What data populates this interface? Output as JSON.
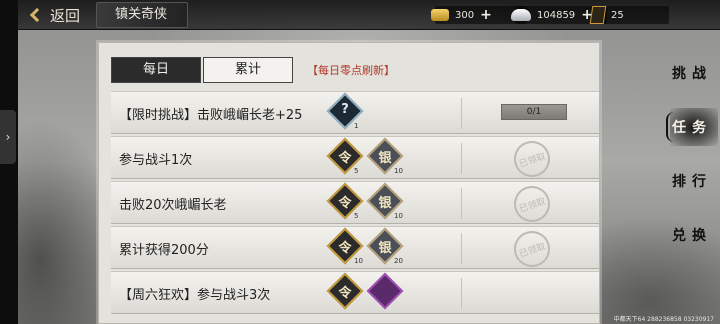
{
  "header": {
    "back_label": "返回",
    "title": "镇关奇侠",
    "gold": "300",
    "silver": "104859",
    "tokens": "25"
  },
  "tabs": {
    "daily": "每日",
    "cumulative": "累计",
    "refresh_note": "【每日零点刷新】"
  },
  "tasks": [
    {
      "name": "【限时挑战】击败峨嵋长老+25",
      "rewards": [
        {
          "icon": "mystery-box-icon",
          "count": "1"
        }
      ],
      "status": "0/1"
    },
    {
      "name": "参与战斗1次",
      "rewards": [
        {
          "icon": "token-icon",
          "count": "5"
        },
        {
          "icon": "silver-icon",
          "count": "10"
        }
      ],
      "status": "已领取"
    },
    {
      "name": "击败20次峨嵋长老",
      "rewards": [
        {
          "icon": "token-icon",
          "count": "5"
        },
        {
          "icon": "silver-icon",
          "count": "10"
        }
      ],
      "status": "已领取"
    },
    {
      "name": "累计获得200分",
      "rewards": [
        {
          "icon": "token-icon",
          "count": "10"
        },
        {
          "icon": "silver-icon",
          "count": "20"
        }
      ],
      "status": "已领取"
    },
    {
      "name": "【周六狂欢】参与战斗3次",
      "rewards": [
        {
          "icon": "token-icon",
          "count": ""
        },
        {
          "icon": "gem-icon",
          "count": ""
        }
      ],
      "status": ""
    }
  ],
  "side_nav": {
    "challenge": "挑战",
    "tasks": "任务",
    "ranking": "排行",
    "exchange": "兑换"
  },
  "footer": {
    "text": "中都天下64 288236858 03230917"
  },
  "colors": {
    "accent_red": "#b23a2c",
    "gold": "#c59a3a",
    "dark_tab": "#2b2b2b"
  }
}
